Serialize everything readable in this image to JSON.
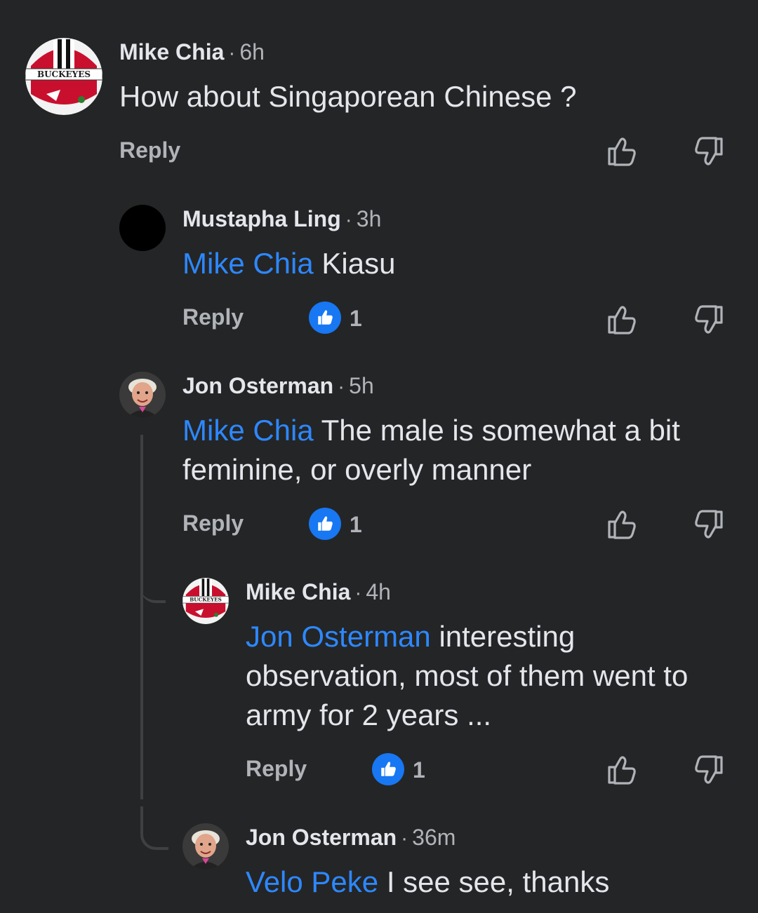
{
  "comments": [
    {
      "author": "Mike Chia",
      "time": "6h",
      "mention": "",
      "text": "How about Singaporean Chinese ?",
      "reply_label": "Reply",
      "likes": "",
      "avatar": "buckeyes-helmet",
      "avatar_text": "BUCKEYES"
    },
    {
      "author": "Mustapha Ling",
      "time": "3h",
      "mention": "Mike Chia",
      "text": "Kiasu",
      "reply_label": "Reply",
      "likes": "1",
      "avatar": "black-circle"
    },
    {
      "author": "Jon Osterman",
      "time": "5h",
      "mention": "Mike Chia",
      "text": "The male is somewhat a bit feminine, or overly manner",
      "reply_label": "Reply",
      "likes": "1",
      "avatar": "man-portrait"
    },
    {
      "author": "Mike Chia",
      "time": "4h",
      "mention": "Jon Osterman",
      "text": "interesting observation, most of them went to army for 2 years ...",
      "reply_label": "Reply",
      "likes": "1",
      "avatar": "buckeyes-helmet",
      "avatar_text": "BUCKEYES"
    },
    {
      "author": "Jon Osterman",
      "time": "36m",
      "mention": "Velo Peke",
      "text": "I see see, thanks",
      "avatar": "man-portrait"
    }
  ],
  "separator": "·",
  "colors": {
    "background": "#242526",
    "mention": "#2d88ff",
    "like_badge": "#1877f2",
    "secondary_text": "#b0b3b8"
  },
  "icons": {
    "upvote": "thumbs-up-outline-icon",
    "downvote": "thumbs-down-outline-icon",
    "like_badge": "like-badge-icon"
  }
}
